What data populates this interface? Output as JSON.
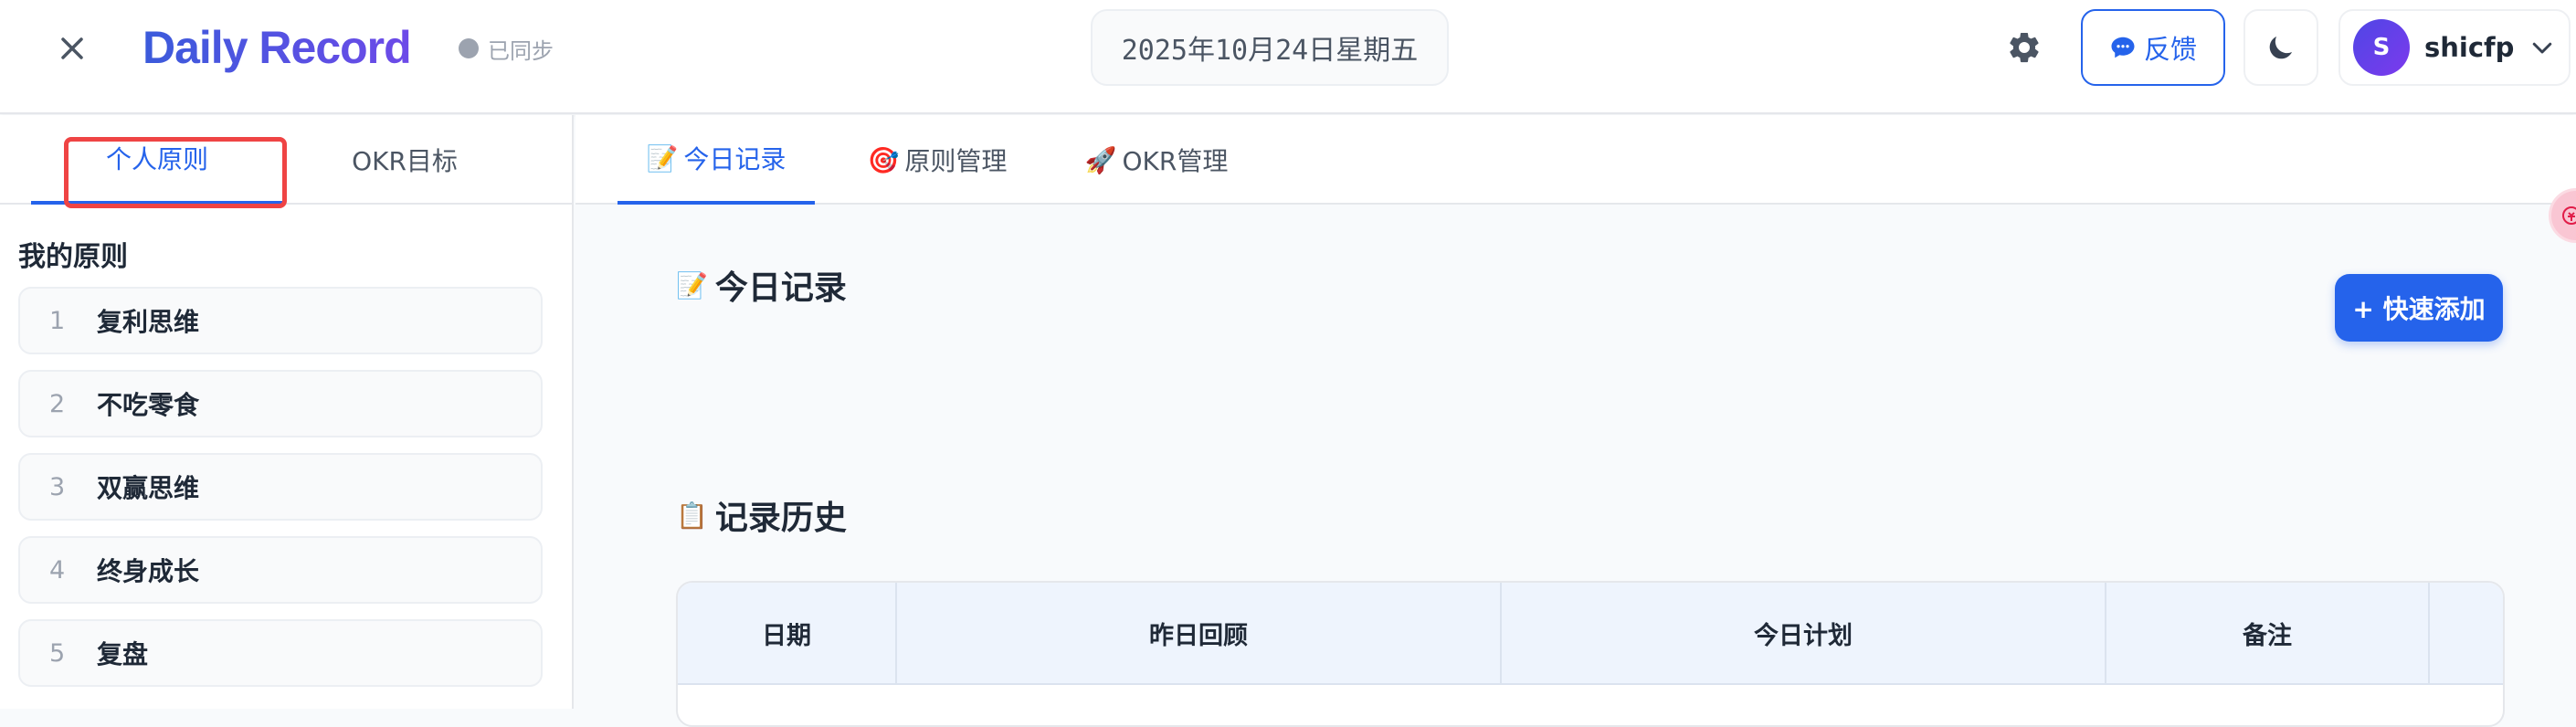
{
  "header": {
    "brand": "Daily Record",
    "sync_status": "已同步",
    "date": "2025年10月24日星期五",
    "feedback_label": "反馈",
    "username": "shicfp",
    "avatar_initial": "S",
    "colors": {
      "primary": "#2563eb",
      "brand_start": "#3b5bdb",
      "brand_end": "#6d4ae8",
      "highlight": "#ef4444"
    }
  },
  "sidebar": {
    "tabs": [
      {
        "label": "个人原则"
      },
      {
        "label": "OKR目标"
      }
    ],
    "section_title": "我的原则",
    "principles": [
      {
        "num": "1",
        "text": "复利思维"
      },
      {
        "num": "2",
        "text": "不吃零食"
      },
      {
        "num": "3",
        "text": "双赢思维"
      },
      {
        "num": "4",
        "text": "终身成长"
      },
      {
        "num": "5",
        "text": "复盘"
      }
    ]
  },
  "main": {
    "tabs": [
      {
        "emoji": "📝",
        "label": "今日记录"
      },
      {
        "emoji": "🎯",
        "label": "原则管理"
      },
      {
        "emoji": "🚀",
        "label": "OKR管理"
      }
    ],
    "today": {
      "emoji": "📝",
      "title": "今日记录"
    },
    "quick_add_label": "+ 快速添加",
    "history": {
      "emoji": "📋",
      "title": "记录历史",
      "columns": [
        "日期",
        "昨日回顾",
        "今日计划",
        "备注",
        ""
      ]
    }
  }
}
